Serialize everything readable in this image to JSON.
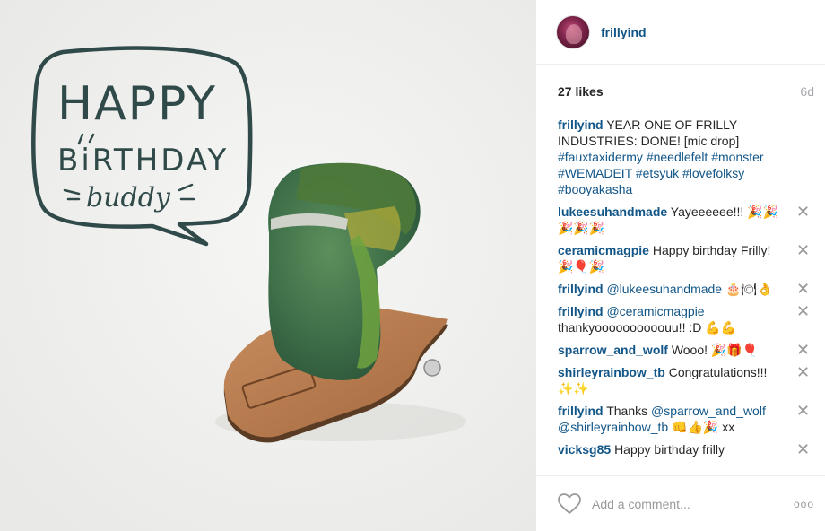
{
  "photo": {
    "bubble_line1": "HAPPY",
    "bubble_line2": "BiRTHDAY",
    "bubble_line3": "buddy",
    "ink_color": "#2f4a48"
  },
  "header": {
    "username": "frillyind"
  },
  "meta": {
    "likes": "27 likes",
    "age": "6d"
  },
  "caption": {
    "user": "frillyind",
    "text": "YEAR ONE OF FRILLY INDUSTRIES: DONE! [mic drop]",
    "tags": "#fauxtaxidermy #needlefelt #monster #WEMADEIT #etsyuk #lovefolksy #booyakasha"
  },
  "comments": [
    {
      "user": "lukeesuhandmade",
      "text": "Yayeeeeee!!! 🎉🎉🎉🎉🎉"
    },
    {
      "user": "ceramicmagpie",
      "text": "Happy birthday Frilly! 🎉🎈🎉"
    },
    {
      "user": "frillyind",
      "mention": "@lukeesuhandmade",
      "text": "🎂🍽👌"
    },
    {
      "user": "frillyind",
      "mention": "@ceramicmagpie",
      "text": "thankyoooooooooouu!! :D 💪💪"
    },
    {
      "user": "sparrow_and_wolf",
      "text": "Wooo! 🎉🎁🎈"
    },
    {
      "user": "shirleyrainbow_tb",
      "text": "Congratulations!!! ✨✨"
    },
    {
      "user": "frillyind",
      "prefix": "Thanks",
      "mention": "@sparrow_and_wolf",
      "mention2": "@shirleyrainbow_tb",
      "text": "👊👍🎉 xx"
    },
    {
      "user": "vicksg85",
      "text": "Happy birthday frilly"
    }
  ],
  "footer": {
    "placeholder": "Add a comment...",
    "more": "ooo"
  },
  "colors": {
    "link": "#125688",
    "muted": "#999999",
    "photo_bg": "#f1f1f0"
  }
}
